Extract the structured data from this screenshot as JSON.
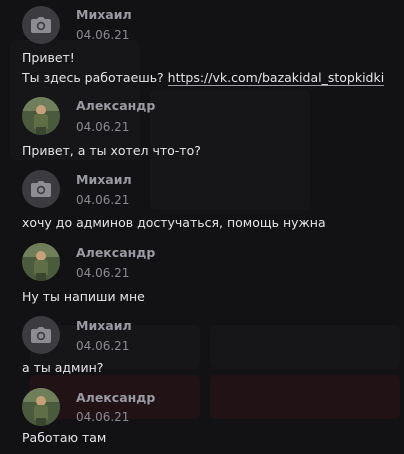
{
  "messages": [
    {
      "author": "Михаил",
      "date": "04.06.21",
      "avatar": "camera-placeholder-icon",
      "lines": [
        "Привет!",
        "Ты здесь работаешь? "
      ],
      "link": "https://vk.com/bazakidal_stopkidki"
    },
    {
      "author": "Александр",
      "date": "04.06.21",
      "avatar": "user-photo",
      "text": "Привет, а ты хотел что-то?"
    },
    {
      "author": "Михаил",
      "date": "04.06.21",
      "avatar": "camera-placeholder-icon",
      "text": "хочу до админов достучаться, помощь нужна"
    },
    {
      "author": "Александр",
      "date": "04.06.21",
      "avatar": "user-photo",
      "text": "Ну ты напиши мне"
    },
    {
      "author": "Михаил",
      "date": "04.06.21",
      "avatar": "camera-placeholder-icon",
      "text": "а ты админ?"
    },
    {
      "author": "Александр",
      "date": "04.06.21",
      "avatar": "user-photo",
      "text": "Работаю там"
    }
  ],
  "colors": {
    "background": "#151518",
    "text": "#e6e6ea",
    "meta": "#8a8a92"
  }
}
